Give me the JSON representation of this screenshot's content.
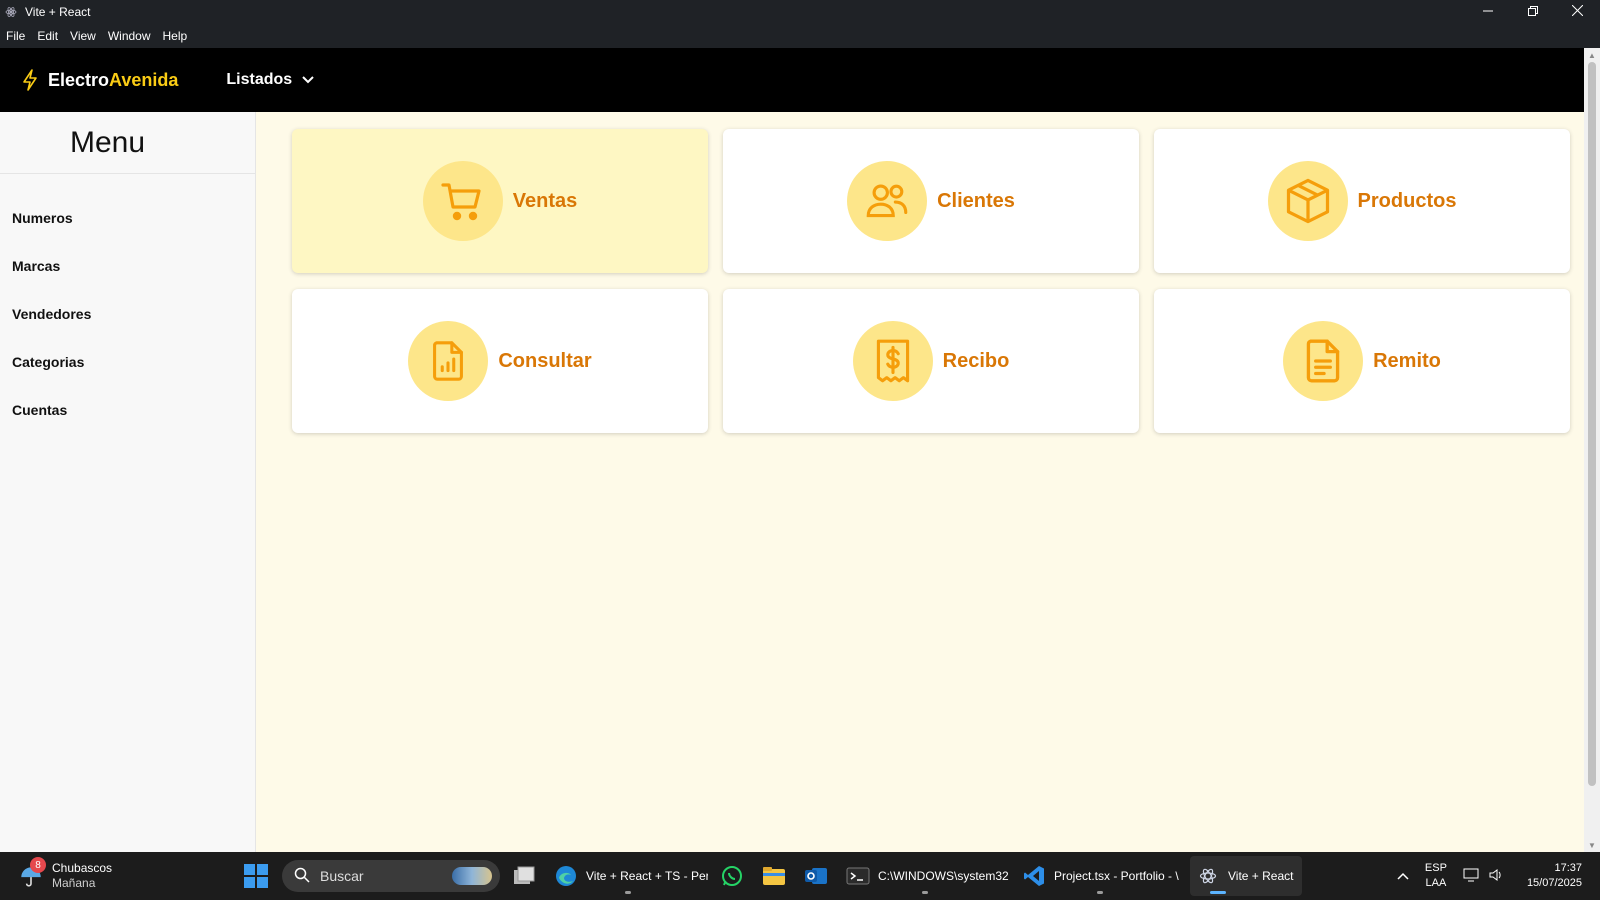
{
  "window": {
    "title": "Vite + React",
    "icon": "react-atom-icon",
    "controls": [
      "minimize-icon",
      "restore-icon",
      "close-icon"
    ]
  },
  "menubar": {
    "items": [
      "File",
      "Edit",
      "View",
      "Window",
      "Help"
    ]
  },
  "topnav": {
    "brand_part1": "Electro",
    "brand_part2": "Avenida",
    "brand_icon": "lightning-bolt-icon",
    "dropdown_label": "Listados"
  },
  "sidebar": {
    "title": "Menu",
    "items": [
      {
        "label": "Numeros"
      },
      {
        "label": "Marcas"
      },
      {
        "label": "Vendedores"
      },
      {
        "label": "Categorias"
      },
      {
        "label": "Cuentas"
      }
    ]
  },
  "cards": [
    {
      "label": "Ventas",
      "icon": "shopping-cart-icon",
      "active": true
    },
    {
      "label": "Clientes",
      "icon": "users-icon",
      "active": false
    },
    {
      "label": "Productos",
      "icon": "package-box-icon",
      "active": false
    },
    {
      "label": "Consultar",
      "icon": "report-chart-icon",
      "active": false
    },
    {
      "label": "Recibo",
      "icon": "receipt-dollar-icon",
      "active": false
    },
    {
      "label": "Remito",
      "icon": "document-text-icon",
      "active": false
    }
  ],
  "colors": {
    "accent": "#facc15",
    "card_label": "#d97706",
    "icon_circle": "#fde68a",
    "active_card": "#fef7c3",
    "background": "#fefae8"
  },
  "taskbar": {
    "weather": {
      "badge": "8",
      "title": "Chubascos",
      "subtitle": "Mañana"
    },
    "search_placeholder": "Buscar",
    "apps": [
      {
        "label": "",
        "icon": "task-view-icon"
      },
      {
        "label": "Vite + React + TS - Pers",
        "icon": "edge-browser-icon"
      },
      {
        "label": "",
        "icon": "whatsapp-icon"
      },
      {
        "label": "",
        "icon": "file-explorer-icon"
      },
      {
        "label": "",
        "icon": "outlook-icon"
      },
      {
        "label": "C:\\WINDOWS\\system32",
        "icon": "terminal-icon"
      },
      {
        "label": "Project.tsx - Portfolio - \\",
        "icon": "vscode-icon"
      },
      {
        "label": "Vite + React",
        "icon": "react-atom-icon"
      }
    ],
    "tray": {
      "lang_top": "ESP",
      "lang_bottom": "LAA",
      "time": "17:37",
      "date": "15/07/2025"
    }
  }
}
